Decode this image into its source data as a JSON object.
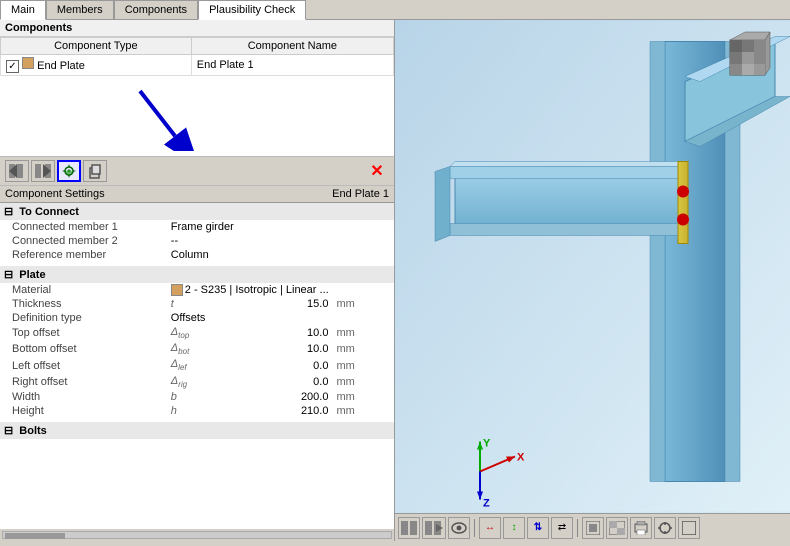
{
  "tabs": [
    {
      "label": "Main",
      "active": false
    },
    {
      "label": "Members",
      "active": false
    },
    {
      "label": "Components",
      "active": false
    },
    {
      "label": "Plausibility Check",
      "active": true
    }
  ],
  "left_panel": {
    "components_header": "Components",
    "table_headers": [
      "Component Type",
      "Component Name"
    ],
    "components": [
      {
        "checked": true,
        "color": "#d4a060",
        "type": "End Plate",
        "name": "End Plate 1"
      }
    ],
    "toolbar_buttons": [
      {
        "name": "move-left-btn",
        "icon": "⇐",
        "interactable": true
      },
      {
        "name": "move-right-btn",
        "icon": "⇒",
        "interactable": true
      },
      {
        "name": "settings-btn",
        "icon": "⚙",
        "interactable": true,
        "highlighted": true
      },
      {
        "name": "import-btn",
        "icon": "📥",
        "interactable": true
      },
      {
        "name": "delete-btn",
        "icon": "✕",
        "interactable": true,
        "color": "red"
      }
    ],
    "settings_header": "Component Settings",
    "settings_name": "End Plate 1",
    "groups": [
      {
        "name": "To Connect",
        "collapsed": false,
        "properties": [
          {
            "label": "Connected member 1",
            "value": "Frame girder",
            "value2": "",
            "unit": ""
          },
          {
            "label": "Connected member 2",
            "value": "--",
            "value2": "",
            "unit": ""
          },
          {
            "label": "Reference member",
            "value": "Column",
            "value2": "",
            "unit": ""
          }
        ]
      },
      {
        "name": "Plate",
        "collapsed": false,
        "properties": [
          {
            "label": "Material",
            "value": "2 - S235 | Isotropic | Linear ...",
            "has_color": true,
            "value2": "",
            "unit": ""
          },
          {
            "label": "Thickness",
            "symbol": "t",
            "value": "",
            "value_right": "15.0",
            "unit": "mm"
          },
          {
            "label": "Definition type",
            "value": "Offsets",
            "value2": "",
            "unit": ""
          },
          {
            "label": "Top offset",
            "symbol": "Δtop",
            "value": "",
            "value_right": "10.0",
            "unit": "mm"
          },
          {
            "label": "Bottom offset",
            "symbol": "Δbot",
            "value": "",
            "value_right": "10.0",
            "unit": "mm"
          },
          {
            "label": "Left offset",
            "symbol": "Δlef",
            "value": "",
            "value_right": "0.0",
            "unit": "mm"
          },
          {
            "label": "Right offset",
            "symbol": "Δrig",
            "value": "",
            "value_right": "0.0",
            "unit": "mm"
          },
          {
            "label": "Width",
            "symbol": "b",
            "value": "",
            "value_right": "200.0",
            "unit": "mm"
          },
          {
            "label": "Height",
            "symbol": "h",
            "value": "",
            "value_right": "210.0",
            "unit": "mm"
          }
        ]
      },
      {
        "name": "Bolts",
        "collapsed": false,
        "properties": []
      }
    ]
  },
  "right_panel": {
    "bottom_buttons": [
      "⊞",
      "⊟",
      "👁",
      "↔",
      "↕",
      "⇅",
      "⇄",
      "▭",
      "▦",
      "🖨",
      "⊗",
      "□"
    ]
  }
}
